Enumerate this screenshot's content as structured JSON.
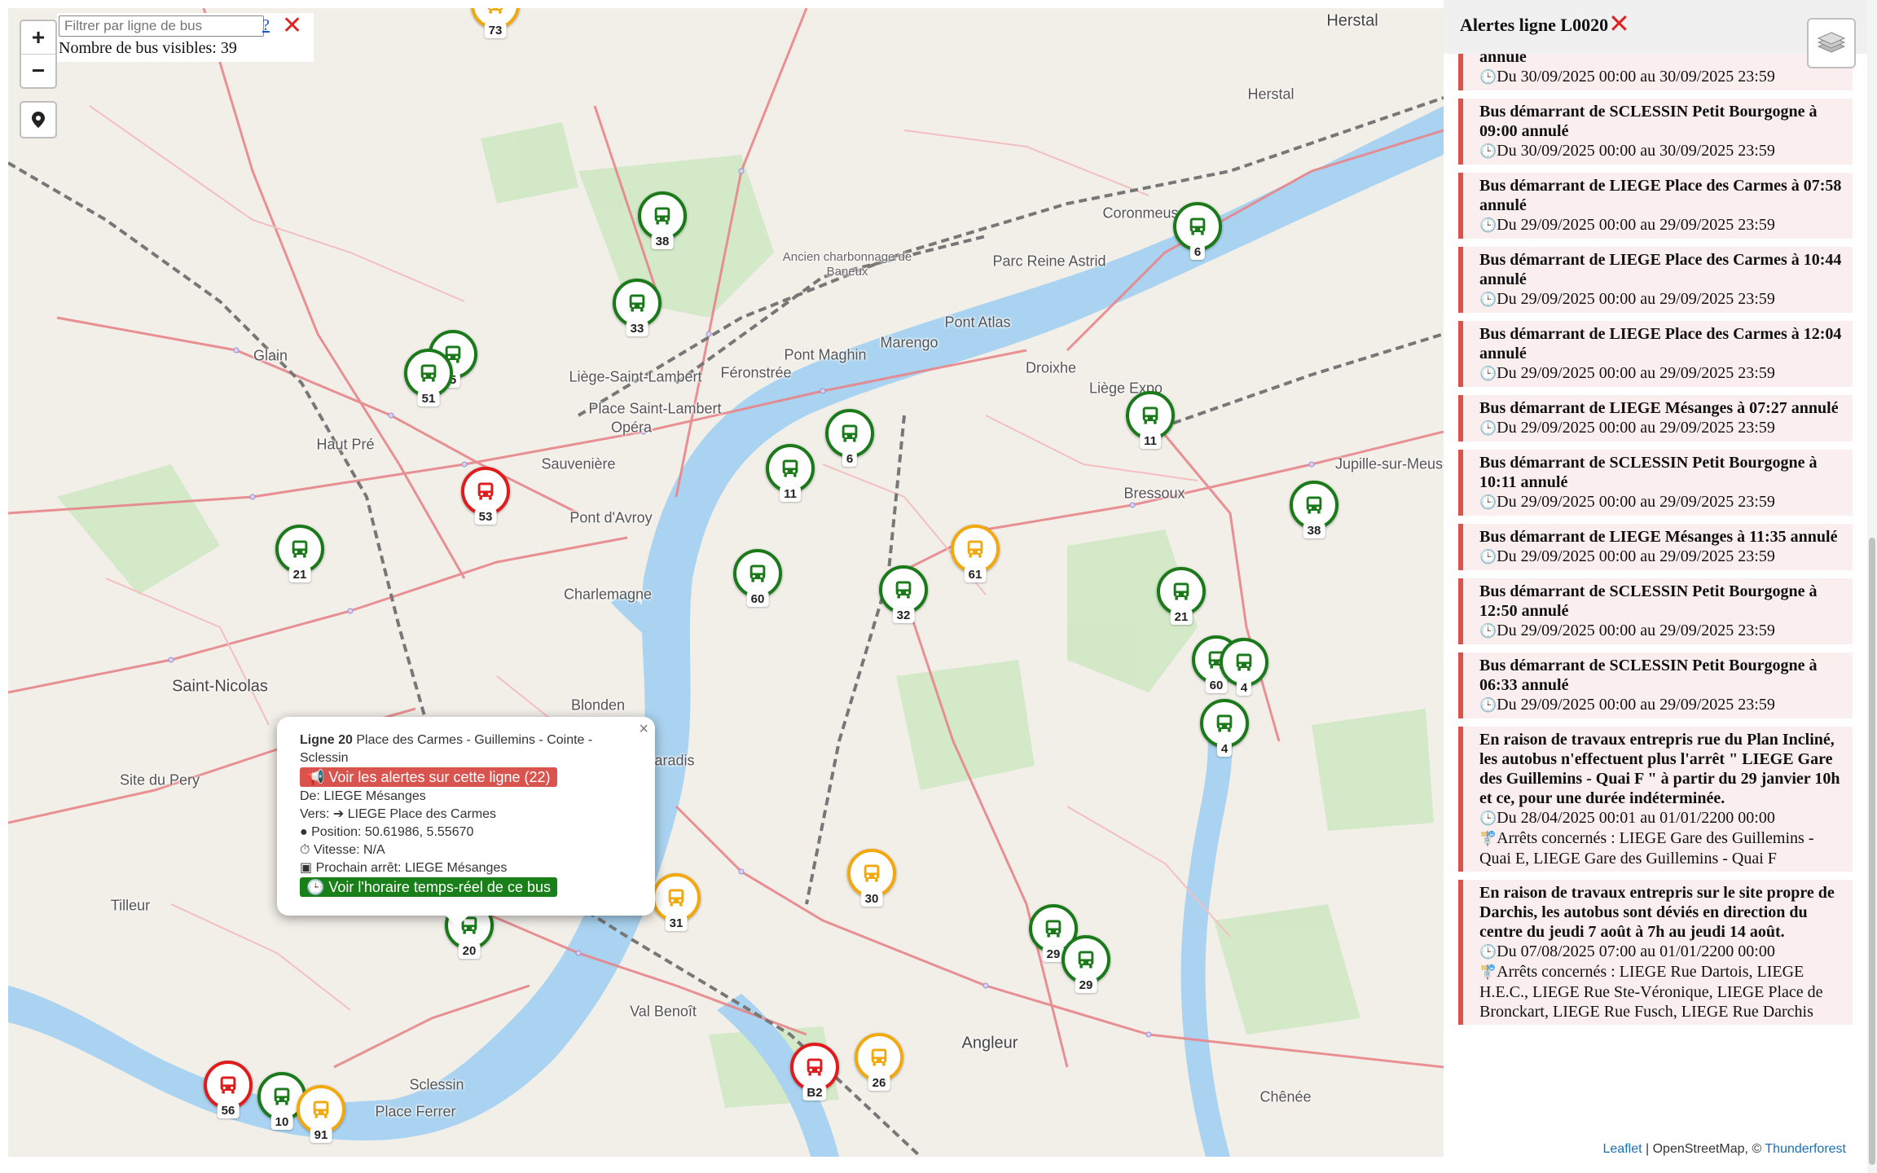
{
  "filter": {
    "placeholder": "Filtrer par ligne de bus",
    "help": "?",
    "clear": "✕",
    "count_label": "Nombre de bus visibles: 39"
  },
  "zoom": {
    "in": "+",
    "out": "−"
  },
  "places": [
    {
      "name": "Herstal",
      "size": "big"
    },
    {
      "name": "Herstal",
      "size": "mid"
    },
    {
      "name": "Coronmeuse",
      "size": "mid"
    },
    {
      "name": "Parc Reine Astrid",
      "size": "mid"
    },
    {
      "name": "Ancien charbonnage de Baneux",
      "size": "small"
    },
    {
      "name": "Pont Atlas",
      "size": "mid"
    },
    {
      "name": "Glain",
      "size": "mid"
    },
    {
      "name": "Liège-Saint-Lambert",
      "size": "mid"
    },
    {
      "name": "Féronstrée",
      "size": "mid"
    },
    {
      "name": "Pont Maghin",
      "size": "mid"
    },
    {
      "name": "Marengo",
      "size": "mid"
    },
    {
      "name": "Droixhe",
      "size": "mid"
    },
    {
      "name": "Liège Expo",
      "size": "mid"
    },
    {
      "name": "Place Saint-Lambert",
      "size": "mid"
    },
    {
      "name": "Opéra",
      "size": "mid"
    },
    {
      "name": "Haut Pré",
      "size": "mid"
    },
    {
      "name": "Sauvenière",
      "size": "mid"
    },
    {
      "name": "Jupille-sur-Meuse",
      "size": "mid"
    },
    {
      "name": "Bressoux",
      "size": "mid"
    },
    {
      "name": "Pont d'Avroy",
      "size": "mid"
    },
    {
      "name": "Charlemagne",
      "size": "mid"
    },
    {
      "name": "Saint-Nicolas",
      "size": "big"
    },
    {
      "name": "Blonden",
      "size": "mid"
    },
    {
      "name": "Paradis",
      "size": "mid"
    },
    {
      "name": "Site du Pery",
      "size": "mid"
    },
    {
      "name": "Tilleur",
      "size": "mid"
    },
    {
      "name": "Val Benoît",
      "size": "mid"
    },
    {
      "name": "Angleur",
      "size": "big"
    },
    {
      "name": "Sclessin",
      "size": "mid"
    },
    {
      "name": "Place Ferrer",
      "size": "mid"
    },
    {
      "name": "Chênée",
      "size": "mid"
    }
  ],
  "buses": [
    {
      "line": "73",
      "color": "orange"
    },
    {
      "line": "38",
      "color": "green"
    },
    {
      "line": "33",
      "color": "green"
    },
    {
      "line": "5",
      "color": "green"
    },
    {
      "line": "51",
      "color": "green"
    },
    {
      "line": "53",
      "color": "red"
    },
    {
      "line": "21",
      "color": "green"
    },
    {
      "line": "6",
      "color": "green"
    },
    {
      "line": "11",
      "color": "green"
    },
    {
      "line": "60",
      "color": "green"
    },
    {
      "line": "32",
      "color": "green"
    },
    {
      "line": "61",
      "color": "orange"
    },
    {
      "line": "6",
      "color": "green"
    },
    {
      "line": "11",
      "color": "green"
    },
    {
      "line": "38",
      "color": "green"
    },
    {
      "line": "21",
      "color": "green"
    },
    {
      "line": "60",
      "color": "green"
    },
    {
      "line": "4",
      "color": "green"
    },
    {
      "line": "4",
      "color": "green"
    },
    {
      "line": "30",
      "color": "orange"
    },
    {
      "line": "31",
      "color": "orange"
    },
    {
      "line": "20",
      "color": "green"
    },
    {
      "line": "29",
      "color": "green"
    },
    {
      "line": "29",
      "color": "green"
    },
    {
      "line": "B2",
      "color": "red"
    },
    {
      "line": "26",
      "color": "orange"
    },
    {
      "line": "56",
      "color": "red"
    },
    {
      "line": "10",
      "color": "green"
    },
    {
      "line": "91",
      "color": "orange"
    }
  ],
  "popup": {
    "close": "×",
    "line_label": "Ligne 20",
    "route": " Place des Carmes - Guillemins - Cointe - Sclessin",
    "alerts_btn": "📢 Voir les alertes sur cette ligne (22)",
    "from": "De: LIEGE Mésanges",
    "to": "Vers: ➔ LIEGE Place des Carmes",
    "position": "Position: 50.61986, 5.55670",
    "speed": "Vitesse: N/A",
    "next_stop": "Prochain arrêt: LIEGE Mésanges",
    "schedule_btn": "🕒 Voir l'horaire temps-réel de ce bus"
  },
  "sidebar": {
    "title": "Alertes ligne L0020",
    "close": "✕",
    "alerts": [
      {
        "title": "annulé",
        "date": "Du 30/09/2025 00:00 au 30/09/2025 23:59"
      },
      {
        "title": "Bus démarrant de SCLESSIN Petit Bourgogne à 09:00 annulé",
        "date": "Du 30/09/2025 00:00 au 30/09/2025 23:59"
      },
      {
        "title": "Bus démarrant de LIEGE Place des Carmes à 07:58 annulé",
        "date": "Du 29/09/2025 00:00 au 29/09/2025 23:59"
      },
      {
        "title": "Bus démarrant de LIEGE Place des Carmes à 10:44 annulé",
        "date": "Du 29/09/2025 00:00 au 29/09/2025 23:59"
      },
      {
        "title": "Bus démarrant de LIEGE Place des Carmes à 12:04 annulé",
        "date": "Du 29/09/2025 00:00 au 29/09/2025 23:59"
      },
      {
        "title": "Bus démarrant de LIEGE Mésanges à 07:27 annulé",
        "date": "Du 29/09/2025 00:00 au 29/09/2025 23:59"
      },
      {
        "title": "Bus démarrant de SCLESSIN Petit Bourgogne à 10:11 annulé",
        "date": "Du 29/09/2025 00:00 au 29/09/2025 23:59"
      },
      {
        "title": "Bus démarrant de LIEGE Mésanges à 11:35 annulé",
        "date": "Du 29/09/2025 00:00 au 29/09/2025 23:59"
      },
      {
        "title": "Bus démarrant de SCLESSIN Petit Bourgogne à 12:50 annulé",
        "date": "Du 29/09/2025 00:00 au 29/09/2025 23:59"
      },
      {
        "title": "Bus démarrant de SCLESSIN Petit Bourgogne à 06:33 annulé",
        "date": "Du 29/09/2025 00:00 au 29/09/2025 23:59"
      },
      {
        "title": "En raison de travaux entrepris rue du Plan Incliné, les autobus n'effectuent plus l'arrêt \" LIEGE Gare des Guillemins - Quai F \" à partir du 29 janvier 10h et ce, pour une durée indéterminée.",
        "date": "Du 28/04/2025 00:01 au 01/01/2200 00:00",
        "stops": "Arrêts concernés : LIEGE Gare des Guillemins - Quai E, LIEGE Gare des Guillemins - Quai F"
      },
      {
        "title": "En raison de travaux entrepris sur le site propre de Darchis, les autobus sont déviés en direction du centre du jeudi 7 août à 7h au jeudi 14 août.",
        "date": "Du 07/08/2025 07:00 au 01/01/2200 00:00",
        "stops": "Arrêts concernés : LIEGE Rue Dartois, LIEGE H.E.C., LIEGE Rue Ste-Véronique, LIEGE Place de Bronckart, LIEGE Rue Fusch, LIEGE Rue Darchis"
      }
    ]
  },
  "attribution": {
    "leaflet": "Leaflet",
    "osm": " | OpenStreetMap, © ",
    "tf": "Thunderforest"
  },
  "colors": {
    "green": "#1a7a1a",
    "red": "#e01b1b",
    "orange": "#f2a90f",
    "river": "#a9d3f0",
    "alert_border": "#d9534f"
  }
}
